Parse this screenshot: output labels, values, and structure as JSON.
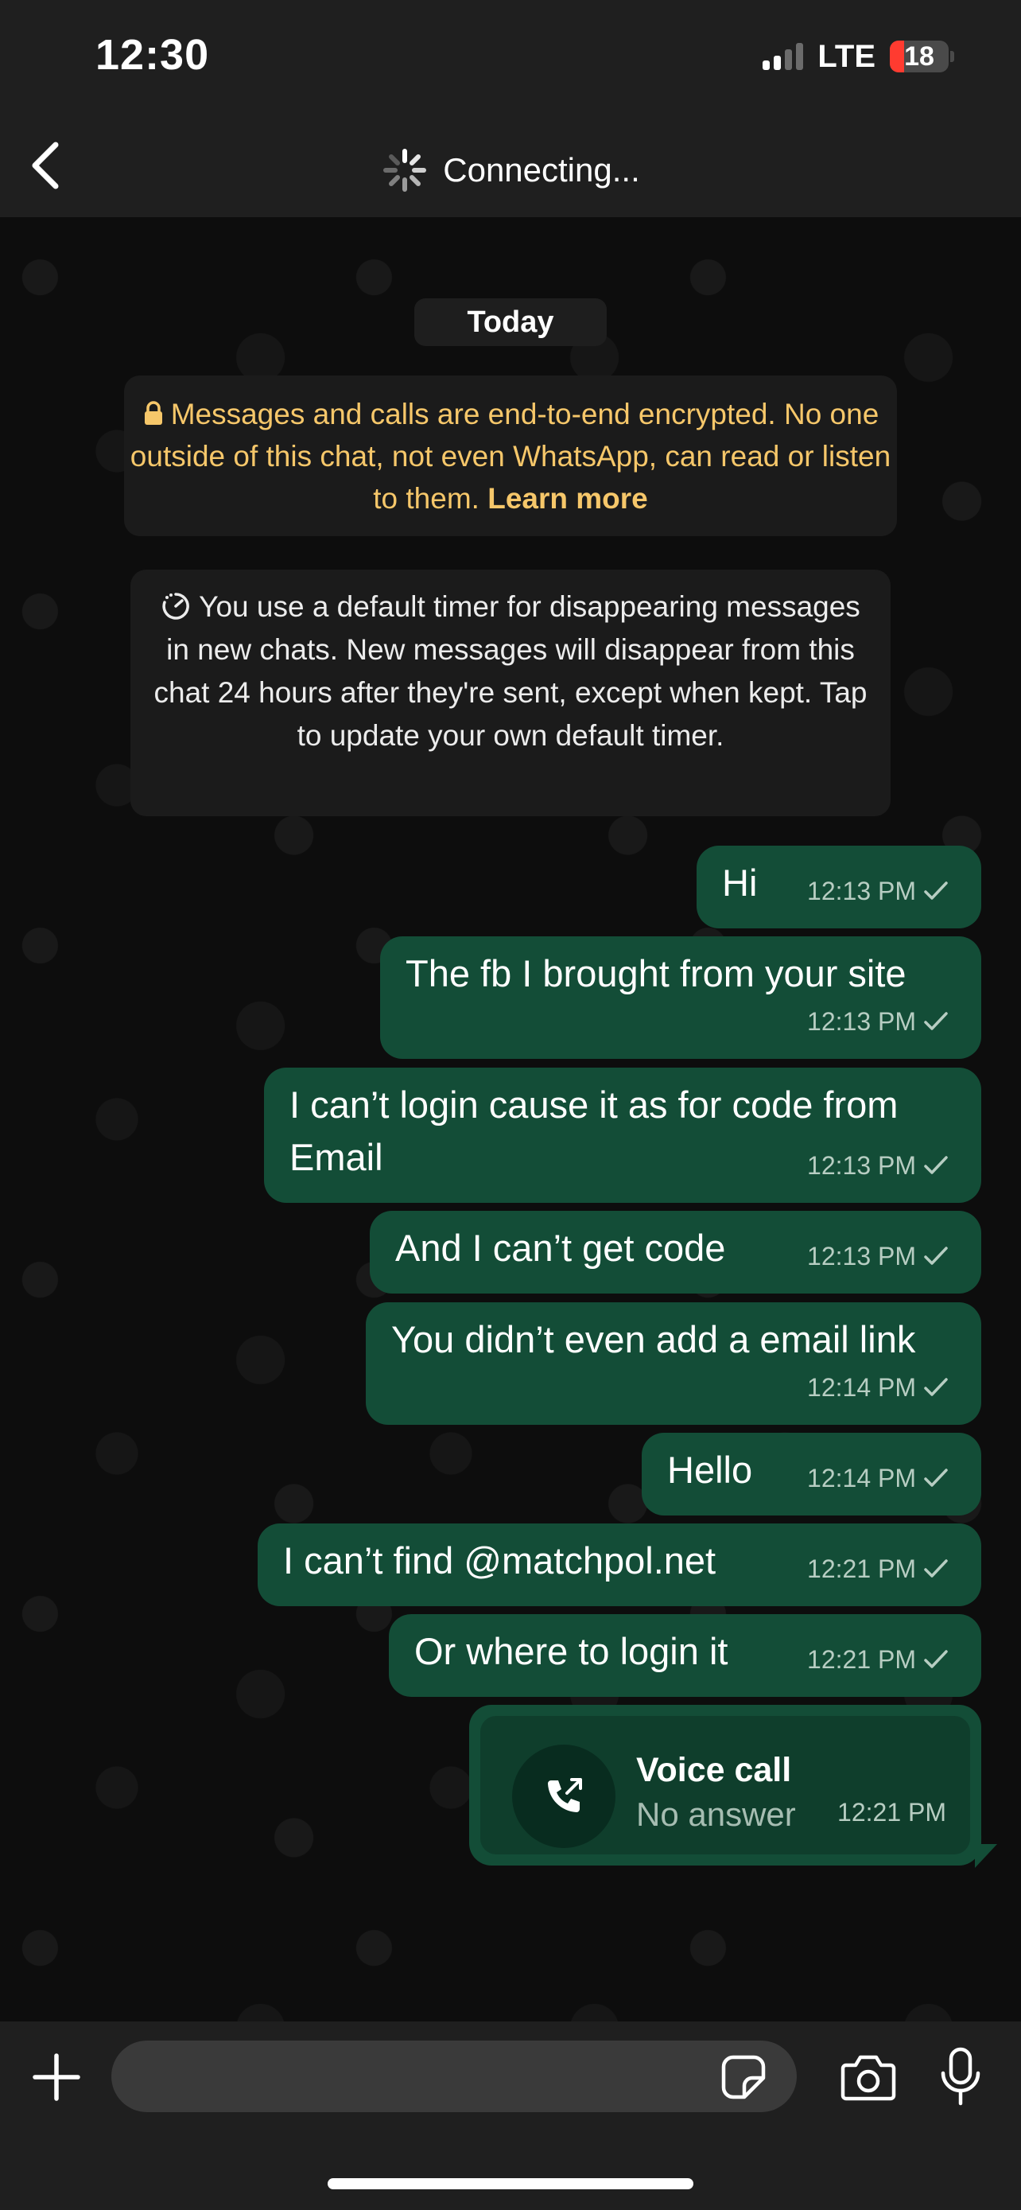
{
  "status_bar": {
    "time": "12:30",
    "network": "LTE",
    "battery": "18"
  },
  "header": {
    "title": "Connecting..."
  },
  "chat": {
    "date_pill": "Today",
    "encryption_notice": {
      "text": "Messages and calls are end-to-end encrypted. No one outside of this chat, not even WhatsApp, can read or listen to them.",
      "link": "Learn more"
    },
    "timer_notice": "You use a default timer for disappearing messages in new chats. New messages will disappear from this chat 24 hours after they're sent, except when kept. Tap to update your own default timer.",
    "messages": [
      {
        "text": "Hi",
        "time": "12:13 PM"
      },
      {
        "text": "The fb I brought from your site",
        "time": "12:13 PM"
      },
      {
        "text": "I can’t login cause it as for code from Email",
        "time": "12:13 PM"
      },
      {
        "text": "And I can’t get code",
        "time": "12:13 PM"
      },
      {
        "text": "You didn’t even add a email link",
        "time": "12:14 PM"
      },
      {
        "text": "Hello",
        "time": "12:14 PM"
      },
      {
        "text": "I can’t find @matchpol.net",
        "time": "12:21 PM"
      },
      {
        "text": "Or where to login it",
        "time": "12:21 PM"
      }
    ],
    "call": {
      "title": "Voice call",
      "subtitle": "No answer",
      "time": "12:21 PM"
    }
  },
  "composer": {
    "placeholder": ""
  },
  "icons": [
    "back-icon",
    "spinner-icon",
    "lock-icon",
    "timer-icon",
    "check-icon",
    "outgoing-call-icon",
    "plus-icon",
    "sticker-icon",
    "camera-icon",
    "mic-icon"
  ],
  "colors": {
    "bubble": "#134d37",
    "notice_text": "#f6c76a",
    "header_bg": "#1f1f1f",
    "battery_low": "#ff3b30"
  }
}
